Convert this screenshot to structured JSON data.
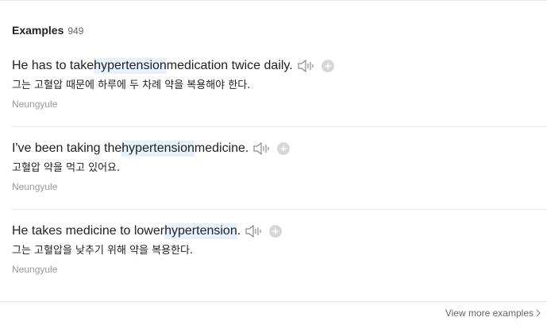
{
  "header": {
    "title": "Examples",
    "count": "949"
  },
  "examples": [
    {
      "before": "He has to take ",
      "term": "hypertension",
      "after": " medication twice daily.",
      "translation": "그는 고혈압 때문에 하루에 두 차례 약을 복용해야 한다.",
      "source": "Neungyule"
    },
    {
      "before": "I've been taking the ",
      "term": "hypertension",
      "after": " medicine.",
      "translation": "고혈압 약을 먹고 있어요.",
      "source": "Neungyule"
    },
    {
      "before": "He takes medicine to lower ",
      "term": "hypertension",
      "after": ".",
      "translation": "그는 고혈압을 낮추기 위해 약을 복용한다.",
      "source": "Neungyule"
    }
  ],
  "footer": {
    "view_more_label": "View more examples"
  },
  "icons": {
    "speaker": "speaker-icon",
    "add": "plus-icon",
    "arrow": "chevron-right-icon"
  },
  "colors": {
    "highlight": "#e6f1fc",
    "muted": "#999999",
    "icon_gray": "#d6d6d6"
  }
}
